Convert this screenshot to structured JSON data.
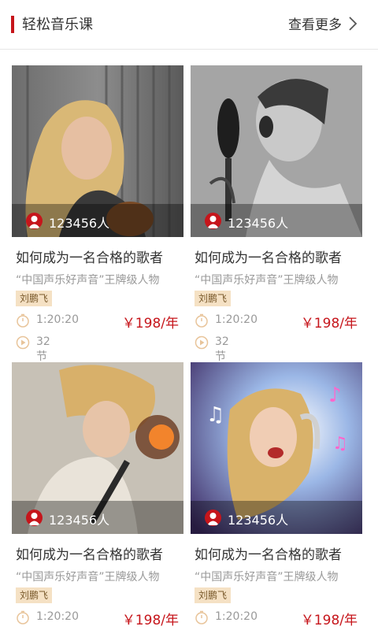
{
  "header": {
    "title": "轻松音乐课",
    "more_label": "查看更多",
    "accent_color": "#c6151b"
  },
  "courses": [
    {
      "learners": "123456人",
      "title": "如何成为一名合格的歌者",
      "subtitle": "“中国声乐好声音”王牌级人物",
      "teacher": "刘鹏飞",
      "duration": "1:20:20",
      "price": "￥198/年",
      "lessons": "32节"
    },
    {
      "learners": "123456人",
      "title": "如何成为一名合格的歌者",
      "subtitle": "“中国声乐好声音”王牌级人物",
      "teacher": "刘鹏飞",
      "duration": "1:20:20",
      "price": "￥198/年",
      "lessons": "32节"
    },
    {
      "learners": "123456人",
      "title": "如何成为一名合格的歌者",
      "subtitle": "“中国声乐好声音”王牌级人物",
      "teacher": "刘鹏飞",
      "duration": "1:20:20",
      "price": "￥198/年"
    },
    {
      "learners": "123456人",
      "title": "如何成为一名合格的歌者",
      "subtitle": "“中国声乐好声音”王牌级人物",
      "teacher": "刘鹏飞",
      "duration": "1:20:20",
      "price": "￥198/年"
    }
  ]
}
